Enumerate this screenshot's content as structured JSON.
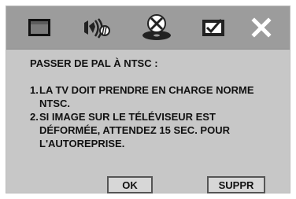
{
  "toolbar": {
    "items": [
      {
        "icon": "screen-icon"
      },
      {
        "icon": "audio-icon"
      },
      {
        "icon": "disc-settings-icon"
      },
      {
        "icon": "checkbox-icon"
      },
      {
        "icon": "close-icon"
      }
    ]
  },
  "message": {
    "title": "PASSER DE PAL À NTSC :",
    "items": [
      {
        "num": "1.",
        "text": "LA TV DOIT PRENDRE EN CHARGE NORME NTSC."
      },
      {
        "num": "2.",
        "text": "SI IMAGE SUR LE TÉLÉVISEUR EST DÉFORMÉE, ATTENDEZ 15 SEC. POUR L'AUTOREPRISE."
      }
    ]
  },
  "buttons": {
    "ok_label": "OK",
    "suppr_label": "SUPPR"
  },
  "colors": {
    "panel": "#c7c7c7",
    "toolbar": "#9c9c9c",
    "icon_dark": "#222222",
    "icon_light": "#ffffff"
  }
}
